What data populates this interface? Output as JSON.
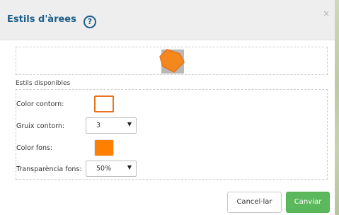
{
  "dialog": {
    "title": "Estils d'àrees",
    "help_symbol": "?",
    "close_symbol": "×"
  },
  "preview": {
    "shape_fill_color": "#ff7f00",
    "shape_background_color": "#b8b8b8"
  },
  "styles": {
    "section_label": "Estils disponibles",
    "outline_color": {
      "label": "Color contorn:",
      "color": "#ffffff"
    },
    "outline_width": {
      "label": "Gruix contorn:",
      "value": "3"
    },
    "fill_color": {
      "label": "Color fons:",
      "color": "#ff7f00"
    },
    "fill_transparency": {
      "label": "Transparència fons:",
      "value": "50%"
    }
  },
  "buttons": {
    "cancel": "Cancel·lar",
    "save": "Canviar"
  },
  "colors": {
    "accent_title": "#1d5f8a",
    "primary_button": "#5cb85c",
    "outline_swatch_border": "#e5731f"
  }
}
